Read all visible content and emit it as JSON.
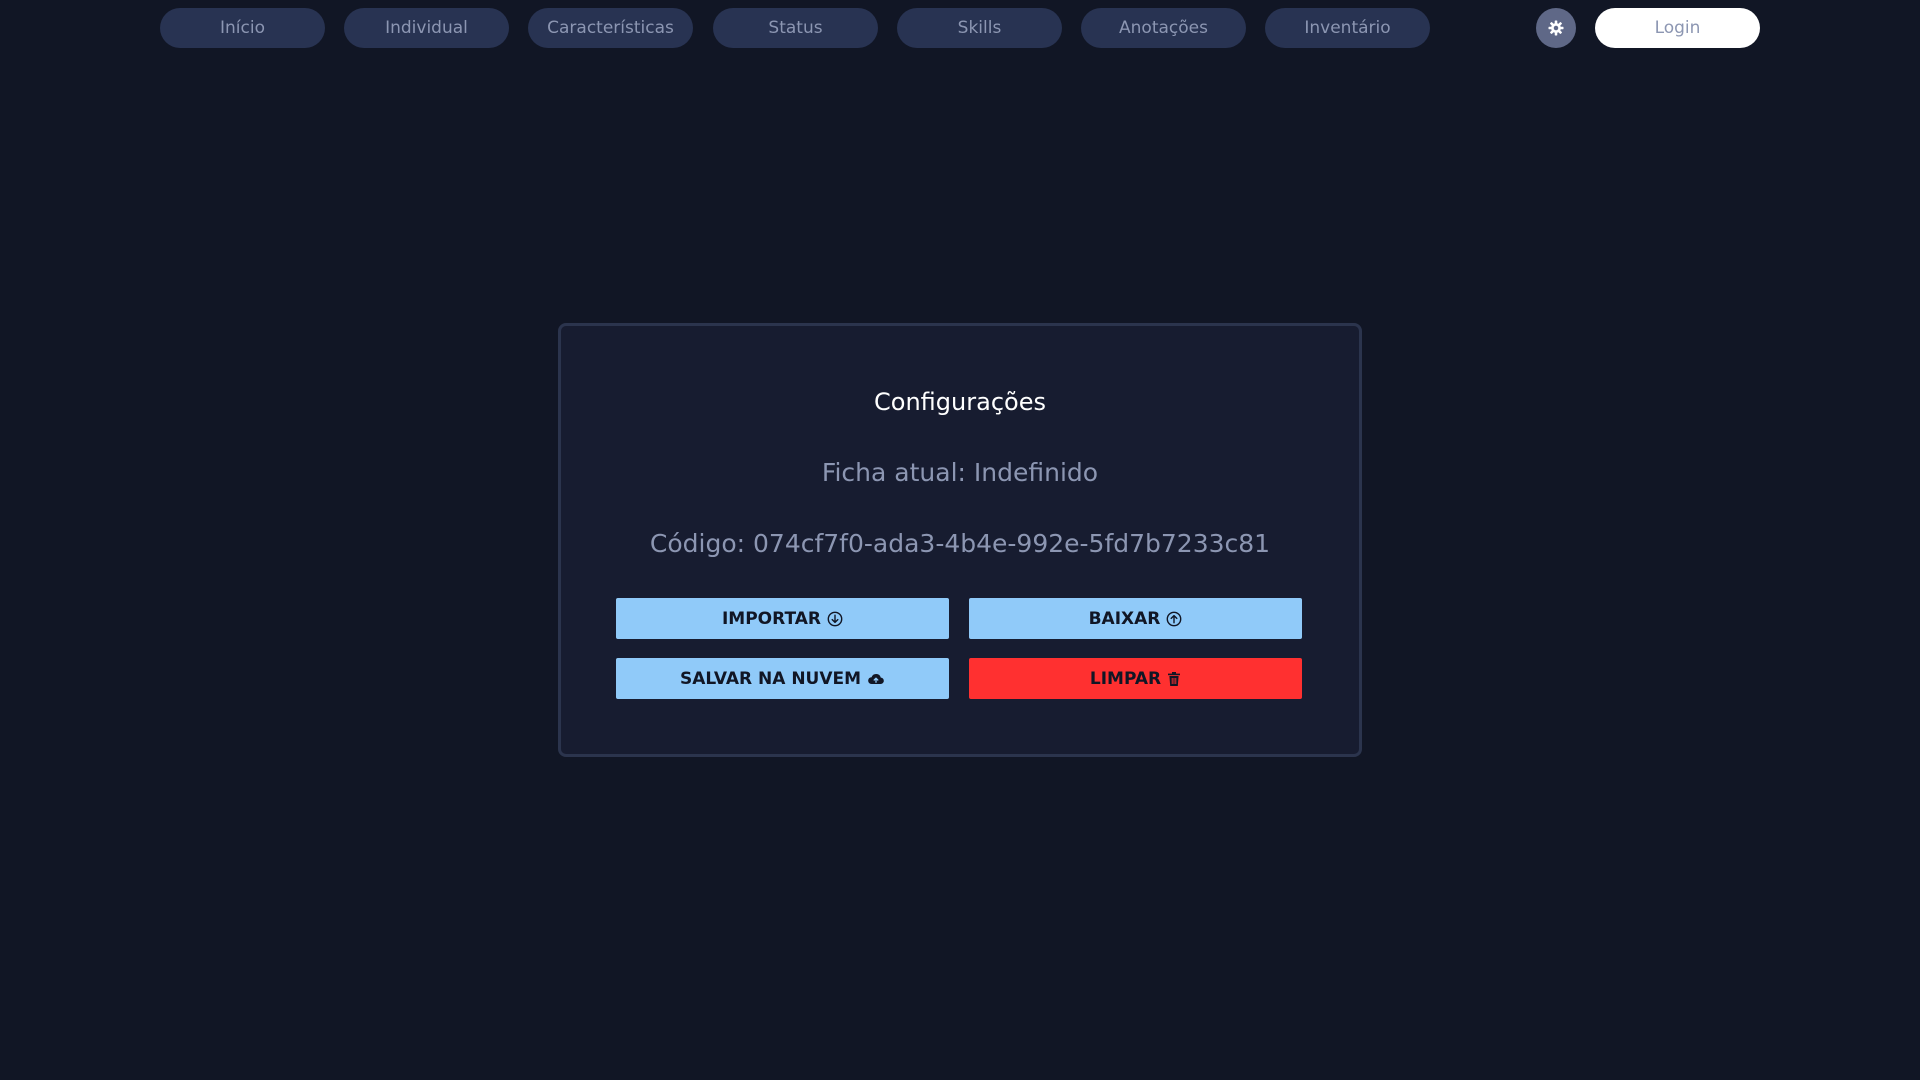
{
  "nav": {
    "items": [
      {
        "label": "Início"
      },
      {
        "label": "Individual"
      },
      {
        "label": "Características"
      },
      {
        "label": "Status"
      },
      {
        "label": "Skills"
      },
      {
        "label": "Anotações"
      },
      {
        "label": "Inventário"
      }
    ],
    "settings_icon": "gear-icon",
    "login_label": "Login"
  },
  "config": {
    "title": "Configurações",
    "ficha_atual": "Ficha atual: Indefinido",
    "codigo": "Código: 074cf7f0-ada3-4b4e-992e-5fd7b7233c81",
    "buttons": {
      "importar": {
        "label": "IMPORTAR",
        "icon": "arrow-down-circle-icon"
      },
      "baixar": {
        "label": "BAIXAR",
        "icon": "arrow-up-circle-icon"
      },
      "salvar": {
        "label": "SALVAR NA NUVEM",
        "icon": "cloud-upload-icon"
      },
      "limpar": {
        "label": "LIMPAR",
        "icon": "trash-icon"
      }
    }
  },
  "colors": {
    "background": "#111625",
    "pill": "#283352",
    "card": "#171c30",
    "button_light": "#90caf9",
    "button_danger": "#ff3030"
  }
}
